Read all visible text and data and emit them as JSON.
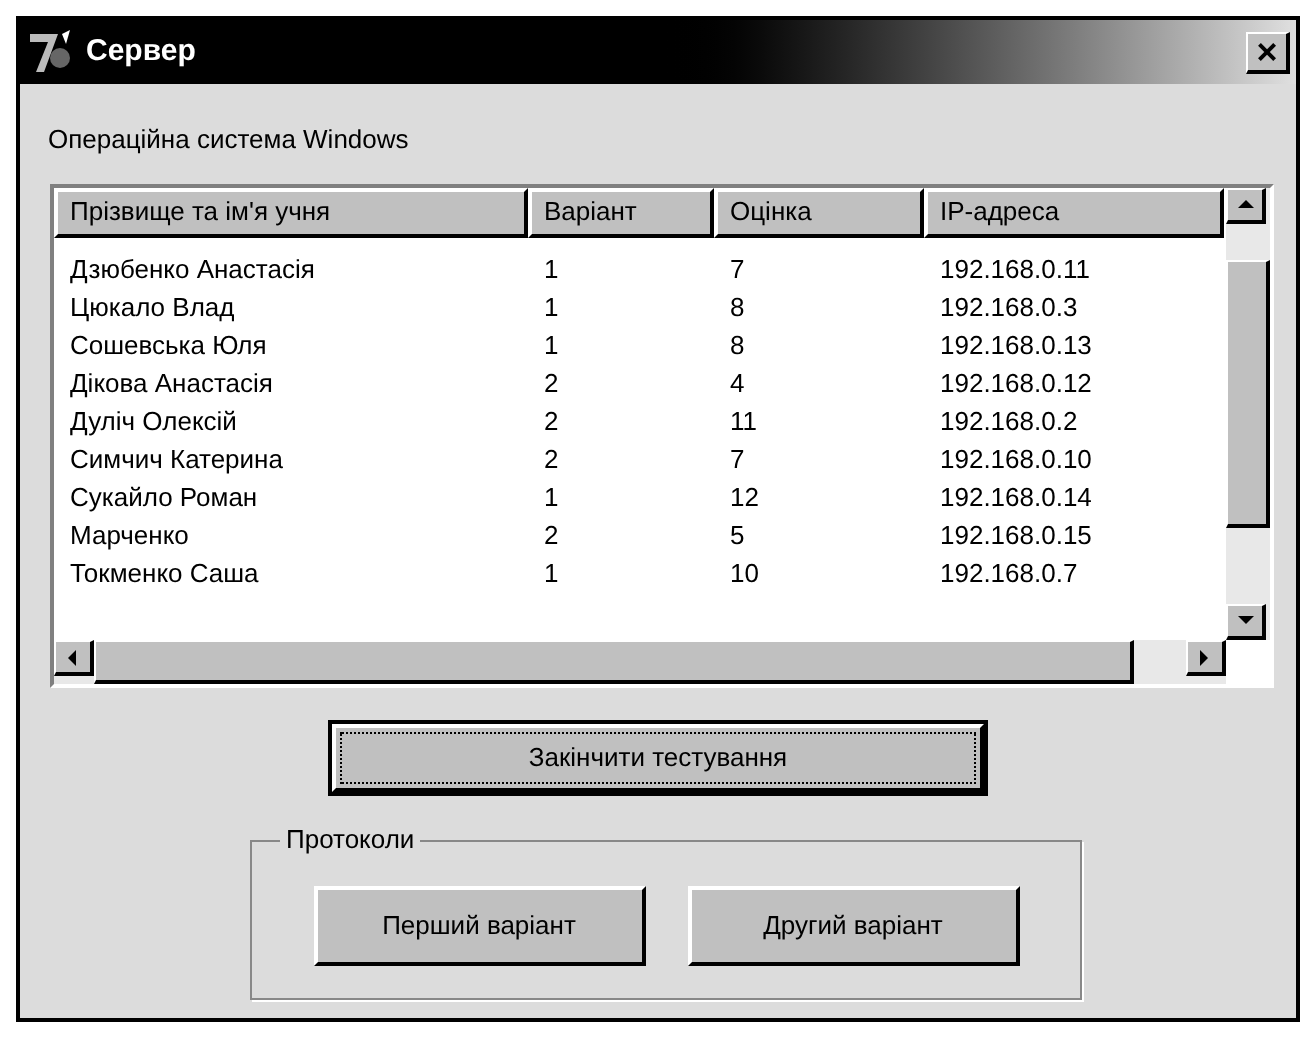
{
  "window": {
    "title": "Сервер",
    "close": "×"
  },
  "os_label": "Операційна система Windows",
  "table": {
    "columns": [
      "Прізвище та ім'я учня",
      "Варіант",
      "Оцінка",
      "IP-адреса"
    ],
    "rows": [
      [
        "Дзюбенко Анастасія",
        "1",
        "7",
        "192.168.0.11"
      ],
      [
        "Цюкало Влад",
        "1",
        "8",
        "192.168.0.3"
      ],
      [
        "Сошевська Юля",
        "1",
        "8",
        "192.168.0.13"
      ],
      [
        "Дікова Анастасія",
        "2",
        "4",
        "192.168.0.12"
      ],
      [
        "Дуліч Олексій",
        "2",
        "11",
        "192.168.0.2"
      ],
      [
        "Симчич Катерина",
        "2",
        "7",
        "192.168.0.10"
      ],
      [
        "Сукайло Роман",
        "1",
        "12",
        "192.168.0.14"
      ],
      [
        "Марченко",
        "2",
        "5",
        "192.168.0.15"
      ],
      [
        "Токменко Саша",
        "1",
        "10",
        "192.168.0.7"
      ]
    ]
  },
  "finish_button": "Закінчити тестування",
  "protocols": {
    "title": "Протоколи",
    "buttons": [
      "Перший варіант",
      "Другий варіант"
    ]
  }
}
